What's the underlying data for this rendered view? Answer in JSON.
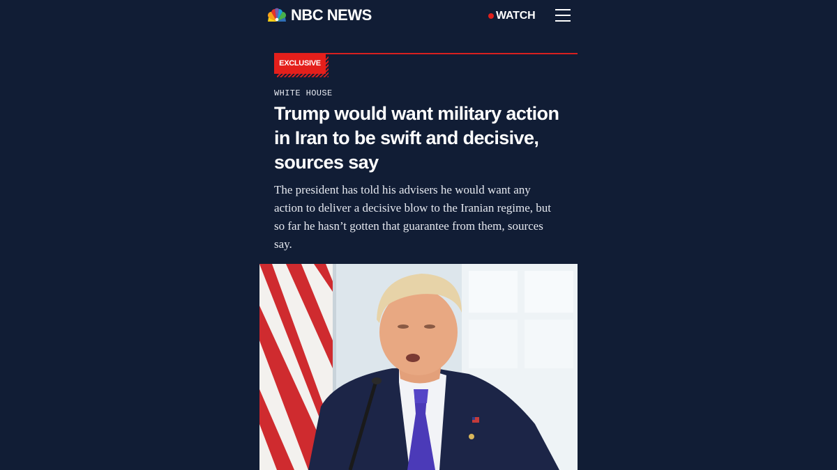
{
  "header": {
    "brand": "NBC NEWS",
    "logo_icon": "peacock-icon",
    "watch_label": "WATCH",
    "menu_icon": "hamburger-menu-icon"
  },
  "article": {
    "badge": "EXCLUSIVE",
    "section": "WHITE HOUSE",
    "headline_lines": [
      "Trump would want military action",
      "in Iran to be swift and decisive,",
      "sources say"
    ],
    "dek_lines": [
      "The president has told his advisers he would want any",
      "action to deliver a decisive blow to the Iranian regime, but",
      "so far he hasn’t gotten that guarantee from them, sources",
      "say."
    ]
  },
  "photo": {
    "subject": "photo of the president speaking at a microphone in front of a flag and window"
  },
  "colors": {
    "background": "#111d35",
    "accent_red": "#e41f1b",
    "text": "#ffffff"
  }
}
